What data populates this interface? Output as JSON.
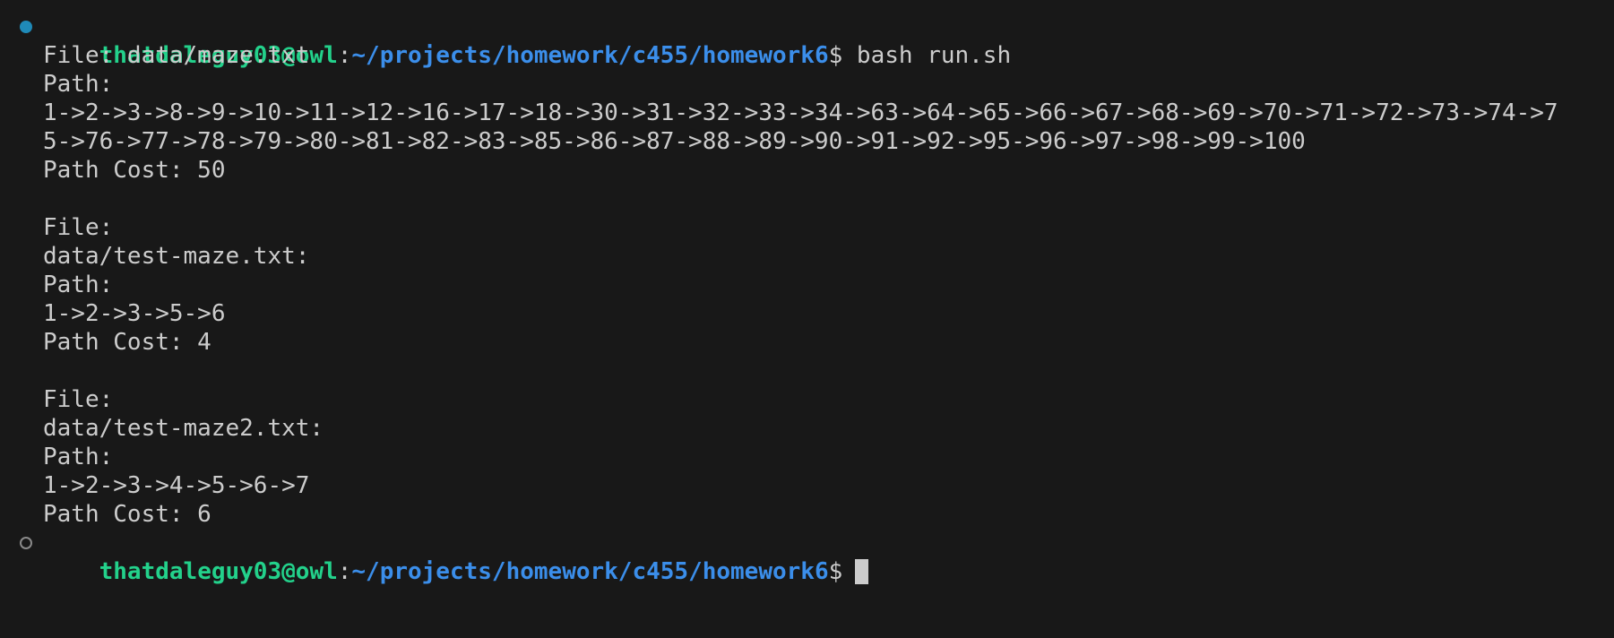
{
  "prompt": {
    "user_host": "thatdaleguy03@owl",
    "separator": ":",
    "cwd": "~/projects/homework/c455/homework6",
    "symbol": "$"
  },
  "command": "bash run.sh",
  "output": {
    "run1": {
      "file_line": "File: data/maze.txt",
      "path_label": "Path:",
      "path_line1": "1->2->3->8->9->10->11->12->16->17->18->30->31->32->33->34->63->64->65->66->67->68->69->70->71->72->73->74->7",
      "path_line2": "5->76->77->78->79->80->81->82->83->85->86->87->88->89->90->91->92->95->96->97->98->99->100",
      "cost": "Path Cost: 50"
    },
    "run2": {
      "file_label": "File:",
      "file_name": "data/test-maze.txt:",
      "path_label": "Path:",
      "path": "1->2->3->5->6",
      "cost": "Path Cost: 4"
    },
    "run3": {
      "file_label": "File:",
      "file_name": "data/test-maze2.txt:",
      "path_label": "Path:",
      "path": "1->2->3->4->5->6->7",
      "cost": "Path Cost: 6"
    }
  },
  "colors": {
    "background": "#181818",
    "text": "#cccccc",
    "user_host": "#23d18b",
    "cwd": "#3b8eea",
    "command_success_dot": "#1f8ab8"
  },
  "icons": {
    "command_status_success": "command-success-dot-icon",
    "command_status_pending": "command-pending-circle-icon"
  }
}
